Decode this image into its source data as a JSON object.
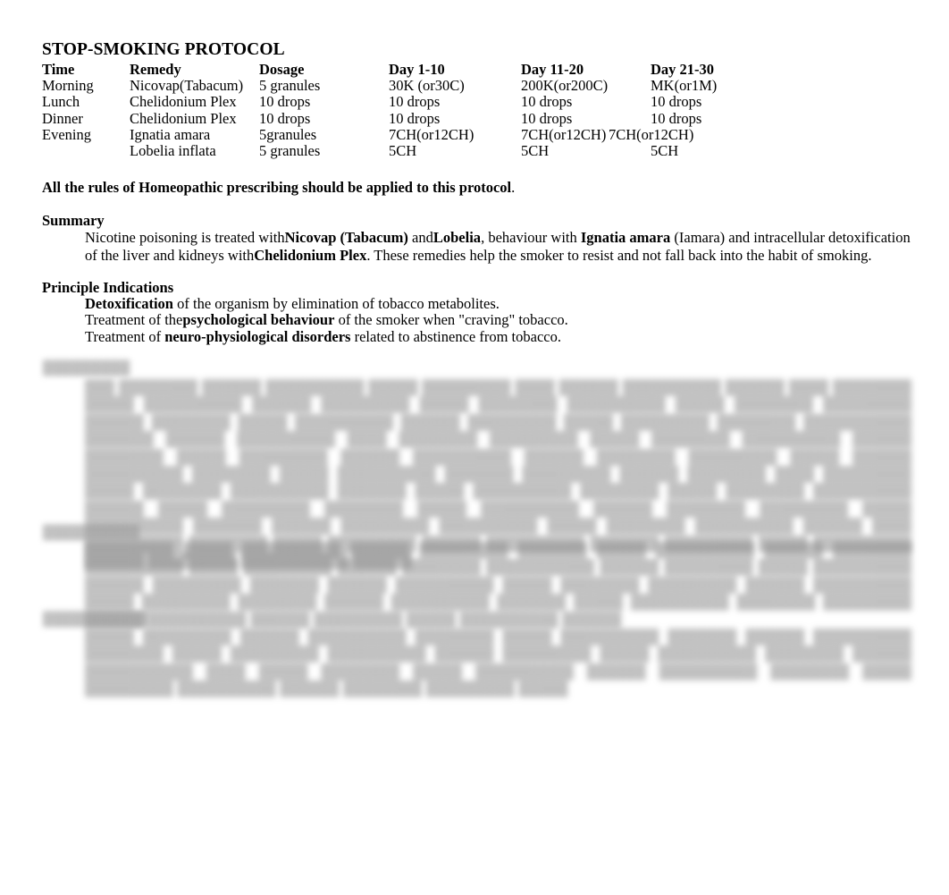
{
  "document": {
    "title": "STOP-SMOKING PROTOCOL"
  },
  "table": {
    "headers": {
      "time": "Time",
      "remedy": "Remedy",
      "dosage": "Dosage",
      "day_1_10": "Day 1-10",
      "day_11_20": "Day 11-20",
      "day_21_30": "Day 21-30"
    },
    "rows": [
      {
        "time": "Morning",
        "remedy": "Nicovap(Tabacum)",
        "dosage": "5 granules",
        "day_1_10": "30K (or30C)",
        "day_11_20": "200K(or200C)",
        "day_21_30": "MK(or1M)"
      },
      {
        "time": "Lunch",
        "remedy": "Chelidonium Plex",
        "dosage": "10 drops",
        "day_1_10": "10 drops",
        "day_11_20": "10 drops",
        "day_21_30": "10 drops"
      },
      {
        "time": "Dinner",
        "remedy": "Chelidonium Plex",
        "dosage": "10 drops",
        "day_1_10": "10 drops",
        "day_11_20": "10 drops",
        "day_21_30": "10 drops"
      },
      {
        "time": "Evening",
        "remedy": "Ignatia amara",
        "dosage": "5granules",
        "day_1_10": "7CH(or12CH)",
        "day_11_20": "7CH(or12CH)",
        "day_21_30": "7CH(or12CH)"
      },
      {
        "time": "",
        "remedy": "Lobelia inflata",
        "dosage": "5 granules",
        "day_1_10": "5CH",
        "day_11_20": "5CH",
        "day_21_30": "5CH"
      }
    ]
  },
  "rule_statement": {
    "bold_text": "All the rules of Homeopathic prescribing should be applied to this protocol",
    "trailing": "."
  },
  "summary": {
    "heading": "Summary",
    "run_1": "Nicotine poisoning is treated with",
    "run_2_bold": "Nicovap (Tabacum)",
    "run_3": " and",
    "run_4_bold": "Lobelia",
    "run_5": ", behaviour with ",
    "run_6_bold": "Ignatia amara",
    "run_7": " (Iamara) and intracellular detoxification of the liver and kidneys with",
    "run_8_bold": "Chelidonium Plex",
    "run_9": ". These remedies help the smoker to resist and not fall back into the habit of smoking."
  },
  "indications": {
    "heading": "Principle Indications",
    "items": [
      {
        "lead_bold": "Detoxification",
        "rest": " of the organism by elimination of tobacco metabolites."
      },
      {
        "prefix": "Treatment of the",
        "bold": "psychological behaviour",
        "rest": " of the smoker when \"craving\" tobacco."
      },
      {
        "prefix": "Treatment of ",
        "bold": "neuro-physiological disorders",
        "rest": " related to abstinence from tobacco."
      }
    ]
  },
  "redacted": {
    "note": "lower section rendered blurred and illegible in the source image",
    "blocks": [
      {
        "heading": "█████████",
        "body": "███ ████████ ██████ ██████████ █████ █████████ ████ ██████ ██████████ ██████ ████ ████████ █████ ██████████ ██████ █████████ █████ ████████ ██████████ █████ ████████ █████████ ██████ ████████ █████ ██████████ ██████ █████████ █████ █████████ ████████ ███████████ ███████ ██████ ██████████\n████ ████████ █████████ █████ ████████ ██████████ ██████ ████████ █████ █████████ ██████ ██████████ ██████ ████████ █████████ █████ ██████ ██████████ ████████ █████ ██████████ ███████ █████████ ██████ ████████\n████ █████████ █████ ████████ ██████████ ███████ █████ ██████████ ████████\n\n█████ ████████ ██████████ ██████ █████ █████████ ████████ █████ ██████████ ██████ ████████ █████████ █████ ██████████ ███████ ██████ █████████ ██████████ █████ ████████ ██████████ ██████\n████ ██████████ ████████ █████ █████████ ██████ ██████████ ███████ █████████ █████ ██████████ ██████ █████████ ███████████ ██████"
      },
      {
        "heading": "██████████",
        "body": "█████████ █████ ██████████ ██████ █████████ ███████ █████ ██████████ ██████ ████████ ██████████ █████ █████████ ██████ ████████ ███████████ ██████ █████████ █████ ██████████ ██████ █████████ ███████\n██████ ██████████ █████ ████████ █████████ ██████ ██████████ █████ █████████ ████████ ██████ ██████████ ███████ █████ ██████████ ████████ █████████ ██████ ██████████\n██████ █████████ █████ ██████████ ██████"
      },
      {
        "heading": "███████████",
        "body": "█████ █████████ ██████ ██████████ ████████ █████ ██████████ ███████ ██████ ██████████ ████████ █████ █████████ ██████████ ██████ █████████ █████ ██████████ ████████ ██████ ███████████ ████\n█████ ████████ █████ ██████████ ██████ ██████████ ████████ █████ █████████ ██████████ ██████ ████████ █████████ █████"
      }
    ]
  }
}
